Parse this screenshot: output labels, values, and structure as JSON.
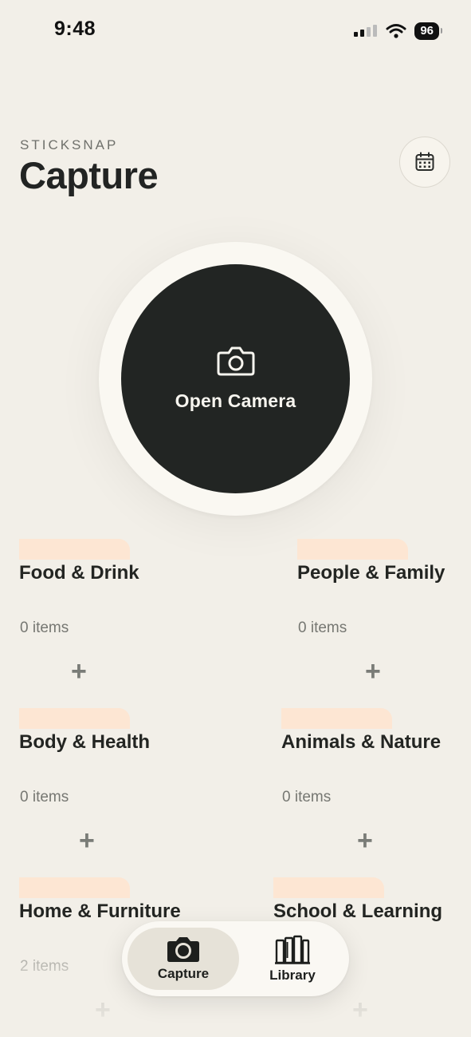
{
  "status_bar": {
    "time": "9:48",
    "battery": "96"
  },
  "header": {
    "app_name": "STICKSNAP",
    "title": "Capture",
    "calendar_icon": "calendar-icon"
  },
  "camera": {
    "label": "Open Camera",
    "icon": "camera-icon"
  },
  "categories": [
    {
      "name": "Food & Drink",
      "count": "0 items",
      "add": "+"
    },
    {
      "name": "People & Family",
      "count": "0 items",
      "add": "+"
    },
    {
      "name": "Body & Health",
      "count": "0 items",
      "add": "+"
    },
    {
      "name": "Animals & Nature",
      "count": "0 items",
      "add": "+"
    },
    {
      "name": "Home & Furniture",
      "count": "2 items",
      "add": "+"
    },
    {
      "name": "School & Learning",
      "count": "",
      "add": "+"
    }
  ],
  "tab_bar": {
    "tabs": [
      {
        "label": "Capture",
        "icon": "camera-icon",
        "selected": true
      },
      {
        "label": "Library",
        "icon": "books-icon",
        "selected": false
      }
    ]
  },
  "colors": {
    "background": "#f2efe8",
    "accent_dark": "#222523",
    "category_tab": "#fde6d3",
    "muted_text": "#767772"
  }
}
